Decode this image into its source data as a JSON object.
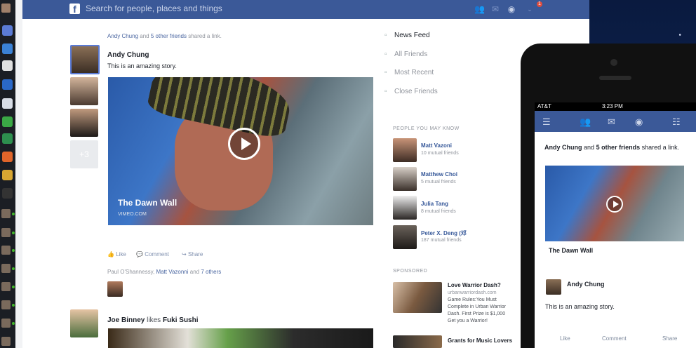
{
  "search": {
    "placeholder": "Search for people, places and things"
  },
  "notifications": {
    "count": "1"
  },
  "feed": {
    "story1": {
      "header_actor": "Andy Chung",
      "header_and": "and",
      "header_others": "5 other friends",
      "header_action": "shared a link.",
      "author": "Andy Chung",
      "text": "This is an amazing story.",
      "video_title": "The Dawn Wall",
      "video_source": "VIMEO.COM",
      "actions": {
        "like": "Like",
        "comment": "Comment",
        "share": "Share"
      }
    },
    "liked_by": {
      "name1": "Paul O'Shannessy,",
      "name2": "Matt Vazonni",
      "and": "and",
      "others": "7 others"
    },
    "story2": {
      "author": "Joe Binney",
      "verb": "likes",
      "page": "Fuki Sushi"
    },
    "more_badge": "+3"
  },
  "right_nav": {
    "items": [
      "News Feed",
      "All Friends",
      "Most Recent",
      "Close Friends"
    ]
  },
  "pymk": {
    "title": "People you may know",
    "people": [
      {
        "name": "Matt Vazoni",
        "sub": "10 mutual friends"
      },
      {
        "name": "Matthew Choi",
        "sub": "5 mutual friends"
      },
      {
        "name": "Julia Tang",
        "sub": "8 mutual friends"
      },
      {
        "name": "Peter X. Deng (邓",
        "sub": "187 mutual friends"
      }
    ]
  },
  "sponsored": {
    "title": "Sponsored",
    "ad1": {
      "title": "Love Warrior Dash?",
      "lines": [
        "urbanwarriordash.com",
        "Game Rules:You Must",
        "Complete in Urban Warrior",
        "Dash. First Prize is $1,000",
        "Get you a Warrior!"
      ]
    },
    "ad2": {
      "title": "Grants for Music Lovers"
    }
  },
  "phone": {
    "carrier": "AT&T",
    "time": "3:23 PM",
    "story_actor": "Andy Chung",
    "story_and": "and",
    "story_others": "5 other friends",
    "story_action": "shared a link.",
    "video_title": "The Dawn Wall",
    "author": "Andy Chung",
    "text": "This is an amazing story.",
    "actions": {
      "like": "Like",
      "comment": "Comment",
      "share": "Share"
    }
  },
  "colors": {
    "brand": "#3b5998",
    "link": "#365899",
    "online": "#42b72a"
  }
}
